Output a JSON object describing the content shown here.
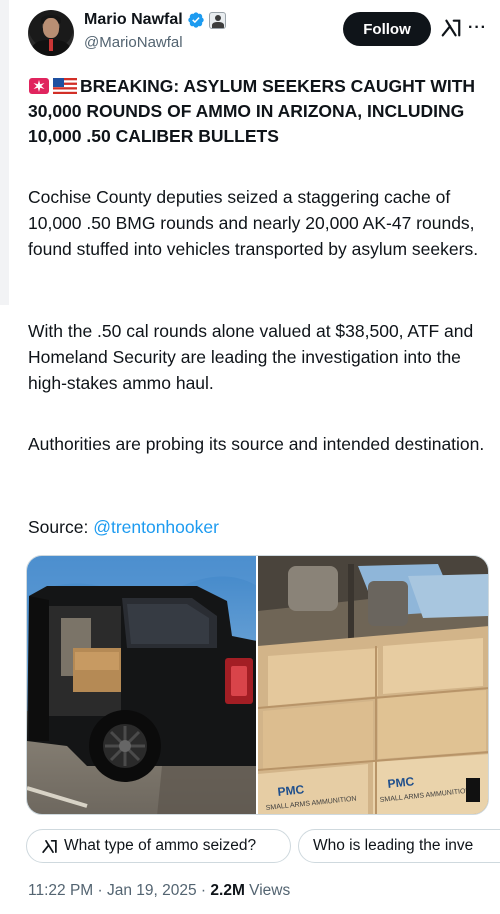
{
  "author": {
    "display_name": "Mario Nawfal",
    "handle": "@MarioNawfal"
  },
  "actions": {
    "follow_label": "Follow"
  },
  "tweet": {
    "headline": "BREAKING: ASYLUM SEEKERS CAUGHT WITH 30,000 ROUNDS OF AMMO IN ARIZONA, INCLUDING 10,000 .50 CALIBER BULLETS",
    "paragraph_1": "Cochise County deputies seized a staggering cache of 10,000 .50 BMG rounds and nearly 20,000 AK-47 rounds, found stuffed into vehicles transported by asylum seekers.",
    "paragraph_2": "With the .50 cal rounds alone valued at $38,500, ATF and Homeland Security are leading the investigation into the high-stakes ammo haul.",
    "paragraph_3": "Authorities are probing its source and intended destination.",
    "source_label": "Source: ",
    "source_link": "@trentonhooker"
  },
  "media": {
    "right_box_brand": "PMC",
    "right_box_label": "SMALL ARMS AMMUNITION"
  },
  "suggestions": [
    {
      "label": "What type of ammo seized?"
    },
    {
      "label": "Who is leading the inve"
    }
  ],
  "meta": {
    "time": "11:22 PM",
    "separator": " · ",
    "date": "Jan 19, 2025",
    "views_count": "2.2M",
    "views_label": " Views"
  },
  "icons": {
    "verified": "verified-badge-icon",
    "affiliate": "affiliate-badge-icon",
    "grok": "grok-icon",
    "more": "more-icon",
    "siren": "siren-emoji-icon",
    "flag": "us-flag-emoji-icon"
  },
  "colors": {
    "link": "#1d9bf0",
    "secondary_text": "#536471",
    "follow_bg": "#0f1419"
  }
}
